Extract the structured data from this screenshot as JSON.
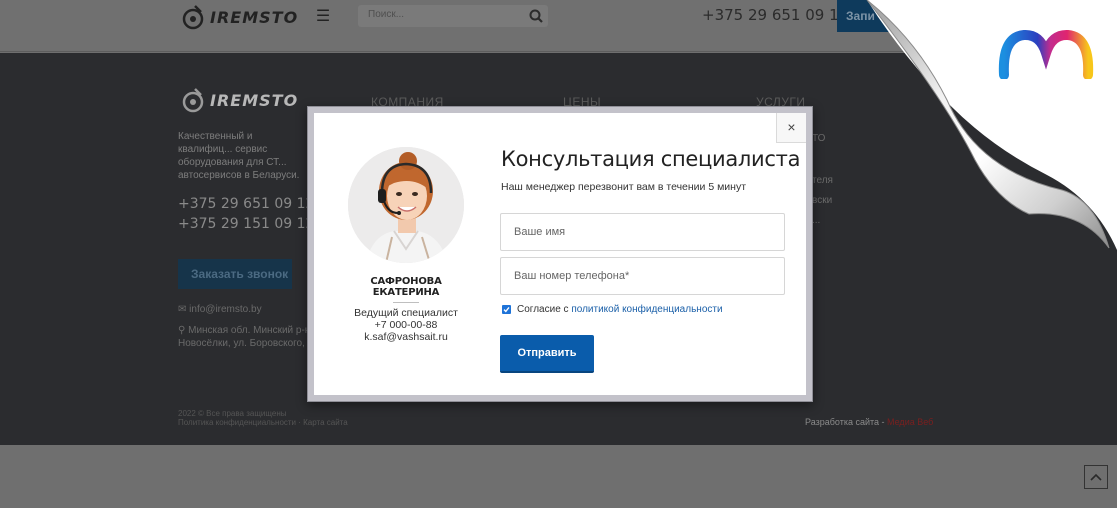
{
  "header": {
    "logo_text": "IREMSTO",
    "search_placeholder": "Поиск...",
    "phone": "+375 29 651 09 12",
    "cta_label": "Запи"
  },
  "footer": {
    "logo_text": "IREMSTO",
    "columns": [
      "КОМПАНИЯ",
      "ЦЕНЫ",
      "УСЛУГИ"
    ],
    "description": "Качественный и квалифиц... сервис оборудования для СТ... автосервисов в Беларуси.",
    "phones": [
      "+375 29 651 09 12",
      "+375 29 151 09 12"
    ],
    "call_button": "Заказать звонок",
    "email": "info@iremsto.by",
    "address": "Минская обл. Минский р-н, Новосёлки, ул. Боровского, 3",
    "copyright": "2022 © Все права защищены",
    "policy_links": "Политика конфиденциальности · Карта сайта",
    "developer_label": "Разработка сайта - ",
    "developer_name": "Медиа Веб",
    "service_items": [
      "ТО",
      "",
      "теля",
      "вски",
      "..."
    ]
  },
  "modal": {
    "close_label": "×",
    "person": {
      "name": "САФРОНОВА ЕКАТЕРИНА",
      "role": "Ведущий специалист",
      "phone": "+7 000-00-88",
      "email": "k.saf@vashsait.ru"
    },
    "title": "Консультация специалиста",
    "subtitle": "Наш менеджер перезвонит вам в течении 5 минут",
    "name_placeholder": "Ваше имя",
    "phone_placeholder": "Ваш номер телефона*",
    "consent_prefix": "Согласие с ",
    "consent_link": "политикой конфиденциальности",
    "consent_checked": true,
    "submit_label": "Отправить"
  },
  "colors": {
    "overlay": "#2b2c2f",
    "submit": "#0a5cab",
    "link": "#1a5fa8",
    "checkbox": "#1e73d8"
  },
  "icons": [
    "menu-icon",
    "search-icon",
    "close-icon",
    "check-icon",
    "mail-icon",
    "map-pin-icon",
    "chevron-up-icon",
    "brand-m-logo"
  ]
}
